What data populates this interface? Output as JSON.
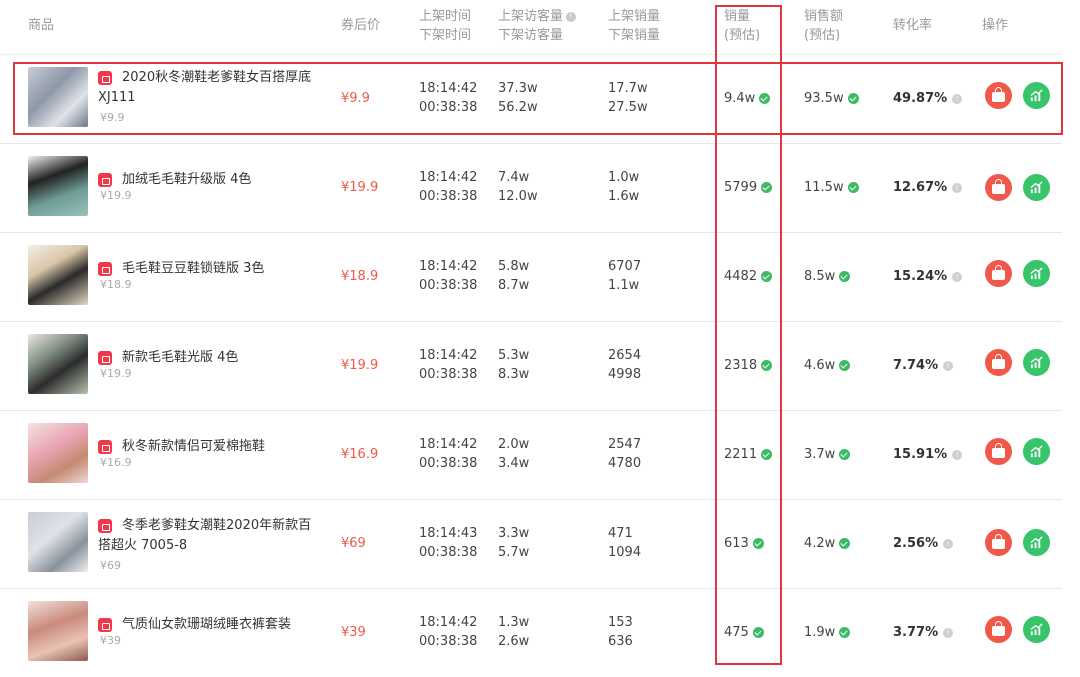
{
  "headers": {
    "product": "商品",
    "coupon_price": "券后价",
    "list_time": "上架时间",
    "delist_time": "下架时间",
    "list_visitors": "上架访客量",
    "delist_visitors": "下架访客量",
    "list_sales": "上架销量",
    "delist_sales": "下架销量",
    "sales": "销量",
    "sales_est": "(预估)",
    "revenue": "销售额",
    "revenue_est": "(预估)",
    "conversion": "转化率",
    "actions": "操作"
  },
  "rows": [
    {
      "name": "2020秋冬潮鞋老爹鞋女百搭厚底 XJ111",
      "orig": "¥9.9",
      "price": "¥9.9",
      "t1": "18:14:42",
      "t2": "00:38:38",
      "v1": "37.3w",
      "v2": "56.2w",
      "s1": "17.7w",
      "s2": "27.5w",
      "sales": "9.4w",
      "revenue": "93.5w",
      "conv": "49.87%"
    },
    {
      "name": "加绒毛毛鞋升级版 4色",
      "orig": "¥19.9",
      "price": "¥19.9",
      "t1": "18:14:42",
      "t2": "00:38:38",
      "v1": "7.4w",
      "v2": "12.0w",
      "s1": "1.0w",
      "s2": "1.6w",
      "sales": "5799",
      "revenue": "11.5w",
      "conv": "12.67%"
    },
    {
      "name": "毛毛鞋豆豆鞋锁链版 3色",
      "orig": "¥18.9",
      "price": "¥18.9",
      "t1": "18:14:42",
      "t2": "00:38:38",
      "v1": "5.8w",
      "v2": "8.7w",
      "s1": "6707",
      "s2": "1.1w",
      "sales": "4482",
      "revenue": "8.5w",
      "conv": "15.24%"
    },
    {
      "name": "新款毛毛鞋光版 4色",
      "orig": "¥19.9",
      "price": "¥19.9",
      "t1": "18:14:42",
      "t2": "00:38:38",
      "v1": "5.3w",
      "v2": "8.3w",
      "s1": "2654",
      "s2": "4998",
      "sales": "2318",
      "revenue": "4.6w",
      "conv": "7.74%"
    },
    {
      "name": "秋冬新款情侣可爱棉拖鞋",
      "orig": "¥16.9",
      "price": "¥16.9",
      "t1": "18:14:42",
      "t2": "00:38:38",
      "v1": "2.0w",
      "v2": "3.4w",
      "s1": "2547",
      "s2": "4780",
      "sales": "2211",
      "revenue": "3.7w",
      "conv": "15.91%"
    },
    {
      "name": "冬季老爹鞋女潮鞋2020年新款百搭超火 7005-8",
      "orig": "¥69",
      "price": "¥69",
      "t1": "18:14:43",
      "t2": "00:38:38",
      "v1": "3.3w",
      "v2": "5.7w",
      "s1": "471",
      "s2": "1094",
      "sales": "613",
      "revenue": "4.2w",
      "conv": "2.56%"
    },
    {
      "name": "气质仙女款珊瑚绒睡衣裤套装",
      "orig": "¥39",
      "price": "¥39",
      "t1": "18:14:42",
      "t2": "00:38:38",
      "v1": "1.3w",
      "v2": "2.6w",
      "s1": "153",
      "s2": "636",
      "sales": "475",
      "revenue": "1.9w",
      "conv": "3.77%"
    }
  ],
  "icons": {
    "shop": "shop-bag-icon",
    "verified": "check-circle-icon",
    "info": "info-icon",
    "action_1": "shopping-bag-icon",
    "action_2": "trend-chart-icon"
  },
  "colors": {
    "price": "#f0584b",
    "highlight": "#e0353c",
    "verified": "#3cba64",
    "action_red": "#f0594a",
    "action_green": "#37c46b"
  }
}
